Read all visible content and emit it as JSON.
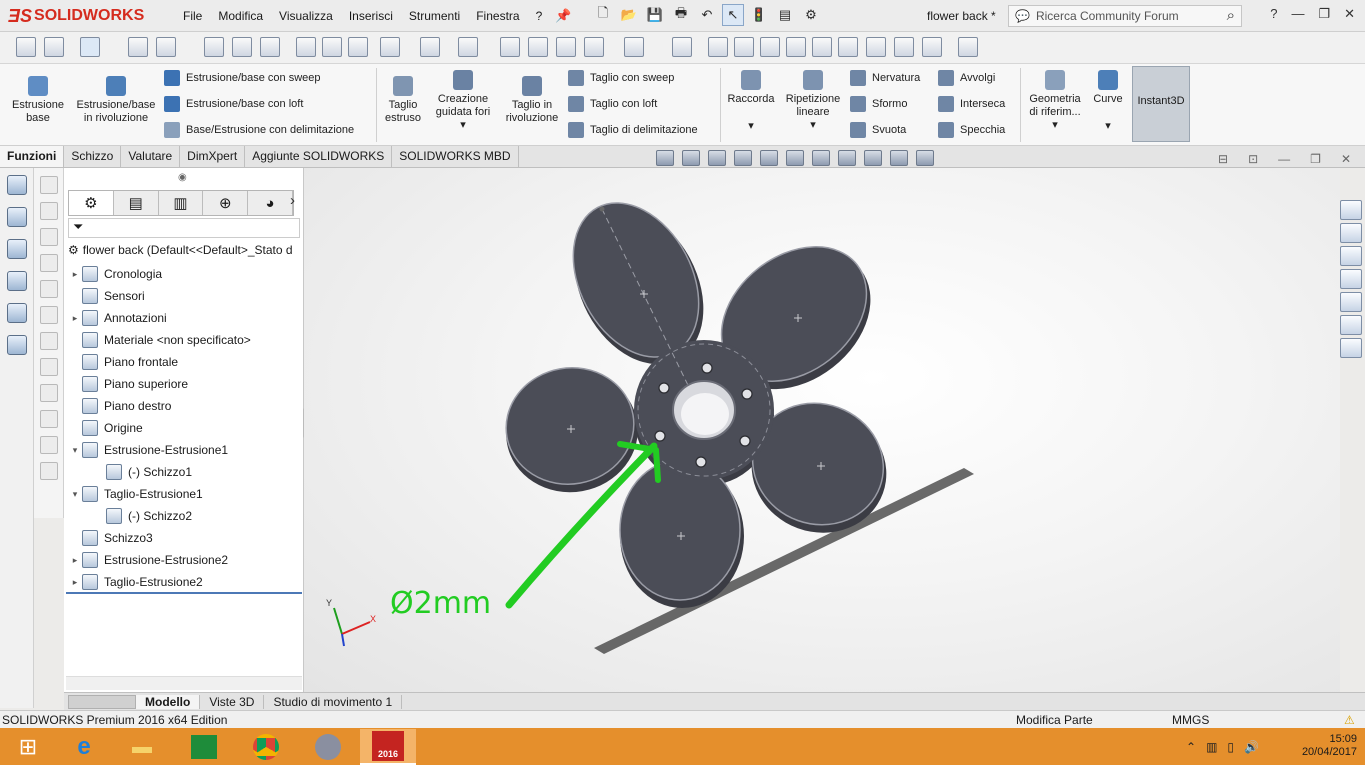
{
  "app": {
    "logo_text": "SOLIDWORKS",
    "doc_title": "flower back *"
  },
  "menu": [
    "File",
    "Modifica",
    "Visualizza",
    "Inserisci",
    "Strumenti",
    "Finestra",
    "?"
  ],
  "search": {
    "placeholder": "Ricerca Community Forum"
  },
  "ribbon": {
    "estrusione_base": "Estrusione base",
    "estrusione_rivoluzione": "Estrusione/base in rivoluzione",
    "sweep": "Estrusione/base con sweep",
    "loft": "Estrusione/base con loft",
    "delimitazione": "Base/Estrusione con delimitazione",
    "taglio_estruso": "Taglio estruso",
    "creazione_fori": "Creazione guidata fori",
    "taglio_rivoluzione": "Taglio in rivoluzione",
    "taglio_sweep": "Taglio con sweep",
    "taglio_loft": "Taglio con loft",
    "taglio_delim": "Taglio di delimitazione",
    "raccorda": "Raccorda",
    "ripetizione": "Ripetizione lineare",
    "nervatura": "Nervatura",
    "sformo": "Sformo",
    "svuota": "Svuota",
    "avvolgi": "Avvolgi",
    "interseca": "Interseca",
    "specchia": "Specchia",
    "geometria": "Geometria di riferim...",
    "curve": "Curve",
    "instant3d": "Instant3D"
  },
  "cmd_tabs": [
    "Funzioni",
    "Schizzo",
    "Valutare",
    "DimXpert",
    "Aggiunte SOLIDWORKS",
    "SOLIDWORKS MBD"
  ],
  "tree": {
    "root": "flower back  (Default<<Default>_Stato d",
    "nodes": [
      {
        "label": "Cronologia"
      },
      {
        "label": "Sensori"
      },
      {
        "label": "Annotazioni"
      },
      {
        "label": "Materiale <non specificato>"
      },
      {
        "label": "Piano frontale"
      },
      {
        "label": "Piano superiore"
      },
      {
        "label": "Piano destro"
      },
      {
        "label": "Origine"
      },
      {
        "label": "Estrusione-Estrusione1"
      },
      {
        "label": "(-) Schizzo1"
      },
      {
        "label": "Taglio-Estrusione1"
      },
      {
        "label": "(-) Schizzo2"
      },
      {
        "label": "Schizzo3"
      },
      {
        "label": "Estrusione-Estrusione2"
      },
      {
        "label": "Taglio-Estrusione2"
      }
    ]
  },
  "bottom_tabs": [
    "Modello",
    "Viste 3D",
    "Studio di movimento 1"
  ],
  "status": {
    "edition": "SOLIDWORKS Premium 2016 x64 Edition",
    "mode": "Modifica Parte",
    "units": "MMGS"
  },
  "annotation": {
    "text": "Ø2mm",
    "color": "#22cc22"
  },
  "axis": {
    "x": "X",
    "y": "Y"
  },
  "clock": {
    "time": "15:09",
    "date": "20/04/2017"
  },
  "taskbar": {
    "sw_label": "2016"
  },
  "colors": {
    "accent": "#d52b1e",
    "taskbar": "#e58f2c",
    "part": "#4b4d57"
  }
}
